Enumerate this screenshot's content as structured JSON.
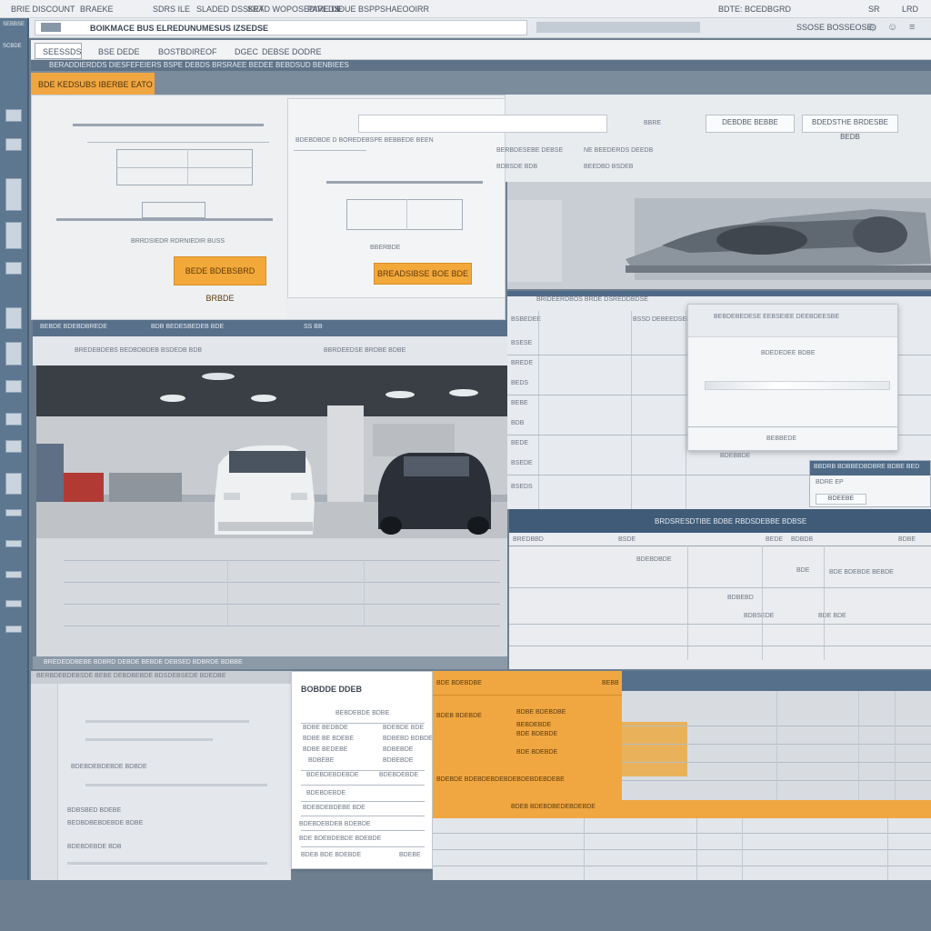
{
  "menubar": {
    "items": [
      "BRIE DISCOUNT",
      "BRAEKE",
      "SDRS ILE",
      "SLADED DSSKET",
      "SRAD WOPOSEDIVEDS",
      "PARE DE",
      "IDUE BSPP",
      "SHAEOOIRR"
    ],
    "right_items": [
      "BDTE: BCEDBGRD",
      "SR",
      "LRD"
    ]
  },
  "addressbar": {
    "title": "BOIKMACE BUS ELREDUNUMESUS IZSEDSE",
    "search_label": "SSOSE BOSSEOSE"
  },
  "tabs": [
    "SEESSDS",
    "BSE DEDE",
    "BOSTBDIREOF",
    "DGEC",
    "DEBSE DODRE"
  ],
  "section_bar_text": "BERADDIERDDS DIESFEFEIERS BSPE DEBDS BRSRAEE BEDEE BEBDSUD BENBIEES",
  "sidebar": {
    "title": "SEBBSE",
    "subtitle": "SCBDE"
  },
  "orange_tab": {
    "label": "BDE KEDSUBS IBERBE EATO"
  },
  "drawing_panel": {
    "left_caption": "BRRDSIEDR RDRNIEDIR BUSS",
    "left_button": "BEDE BDEBSBRD BRBDE",
    "right_header": "BDEBDBDE D BOREDEBSPE BEBBEDE BEEN",
    "right_caption": "BBERBDE",
    "right_button": "BREADSIBSE BOE BDE"
  },
  "form": {
    "label_1": "BBRE",
    "button_1": "DEBDBE BEBBE",
    "button_2": "BDEDSTHE BRDESBE BEDB",
    "row1_label": "BERBDESEBE DEBSE",
    "row1_value": "NE BEEDERDS DEEDB",
    "row2_label": "BDBSDE BDB",
    "row2_value": "BEEDBD BSDEB"
  },
  "table_right": {
    "header": "BRIDEERDBOS BRDE DSREDDBDSE",
    "col_label": "BSBEDEE",
    "col_value": "BSSD DEBEEDSEBE",
    "rows": [
      "BSESE",
      "BREDE",
      "BEDS",
      "BEBE",
      "BDB",
      "BEDE",
      "BSEDE",
      "BSEDS"
    ]
  },
  "modal": {
    "title": "BEBDEBEDESE EEBSEIEE DEEBDEESBE",
    "subtitle": "BDEDEDEE BDBE",
    "footer": "BEBBEDE"
  },
  "side_box": {
    "title": "BBDRB BDBBEDBDBRE BDBE BED",
    "line_1": "BDRE EP",
    "line_2": "BDEBBDE",
    "button": "BDEEBE"
  },
  "dark_band_text": "BRDSRESDTIBE BDBE RBDSDEBBE BDBSE",
  "garage": {
    "header": "BEBDE BDEBDBREDE",
    "header_2": "BDB BEDESBEDEB BDE",
    "header_3": "SS BB",
    "sub_1": "BREDEBDEBS BEDBDBDEB BSDEDB BDB",
    "sub_2": "BBRDEEDSE BRDBE BDBE",
    "caption": "BREDEDDBEBE BDBRD DEBDE BEBDE DEBSED BDBRDE BDBBE"
  },
  "table_mid": {
    "headers": [
      "BREDBBD",
      "BSDE",
      "BEDE",
      "BDBDB",
      "BDBE"
    ],
    "values": [
      "BDEBDBDE",
      "BDE",
      "BDE BDEBDE BEBDE",
      "BDBEBD",
      "BDBSEDE",
      "BDE BDE"
    ]
  },
  "bottom_left": {
    "header": "BERBDEBDEBSDE BEBE DEBDBEBDE BDSDEBSEDE BDEDBE",
    "rows": [
      "BDEBDEBDEBDE BDBDE",
      "BDBSBED BDEBE",
      "BEDBDBEBDEBDE BDBE",
      "BDEBDEBDE BDB"
    ]
  },
  "receipt": {
    "title": "BOBDDE DDEB",
    "subtitle": "BEBDEBDE BDBE",
    "rows": [
      [
        "BDBE BEDBDE",
        "BDEBDE BDE"
      ],
      [
        "BDBE BE BDEBE",
        "BDBEBD BDBDE"
      ],
      [
        "BDBE BEDEBE",
        "BDBEBDE"
      ],
      [
        "BDBEBE",
        "BDBEBDE"
      ]
    ],
    "mid_1": [
      "BDEBDEBDEBDE",
      "BDEBDEBDE"
    ],
    "mid_2": "BDEBDEBDE",
    "mid_3": "BDEBDEBDEBE BDE",
    "line_1": "BDEBDEBDEB BDEBDE",
    "line_2": "BDE BDEBDEBDE BDEBDE",
    "total_label": "BDEB BDE BDEBDE",
    "total_value": "BDEBE"
  },
  "orange_card": {
    "title": "BDE BDEBDBE",
    "link": "BEBB",
    "label_1": "BDBE BDEBDBE",
    "label_2": "BDEB BDEBDE",
    "rows": [
      "BEBDEBDE",
      "BDE BDEBDE",
      "BDE BDEBDE"
    ],
    "footer": "BDEBDE BDEBDEBDEBDEBDEBDEBDEBE"
  },
  "orange_band_text": "BDEB BDEBDBEDEBDEBDE"
}
